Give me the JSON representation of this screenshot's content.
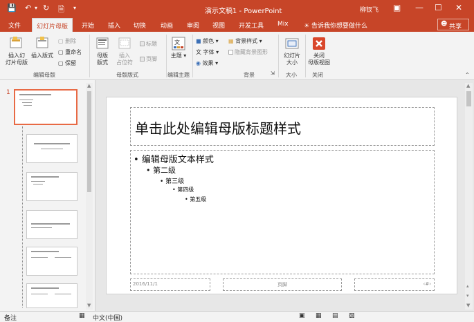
{
  "title_bar": {
    "title": "演示文稿1 - PowerPoint",
    "user": "柳钗飞"
  },
  "tabs": [
    {
      "label": "文件"
    },
    {
      "label": "幻灯片母版"
    },
    {
      "label": "开始"
    },
    {
      "label": "插入"
    },
    {
      "label": "切换"
    },
    {
      "label": "动画"
    },
    {
      "label": "审阅"
    },
    {
      "label": "视图"
    },
    {
      "label": "开发工具"
    },
    {
      "label": "Mix"
    }
  ],
  "tell_me": "告诉我你想要做什么",
  "share": "共享",
  "ribbon": {
    "edit_master": {
      "insert_master": "插入幻\n灯片母版",
      "insert_layout": "插入版式",
      "delete": "删除",
      "rename": "重命名",
      "preserve": "保留",
      "group": "编辑母版"
    },
    "master_layout": {
      "master_layout_btn": "母版\n版式",
      "insert_placeholder": "插入\n占位符",
      "title_chk": "标题",
      "footer_chk": "页脚",
      "group": "母版版式"
    },
    "edit_theme": {
      "theme": "主题",
      "group": "编辑主题"
    },
    "background": {
      "colors": "颜色",
      "fonts": "字体",
      "effects": "效果",
      "bg_styles": "背景样式",
      "hide_bg": "隐藏背景图形",
      "group": "背景"
    },
    "size": {
      "slide_size": "幻灯片\n大小",
      "group": "大小"
    },
    "close": {
      "close_master": "关闭\n母版视图",
      "group": "关闭"
    }
  },
  "thumbnails": {
    "first_number": "1"
  },
  "slide": {
    "title": "单击此处编辑母版标题样式",
    "levels": [
      "编辑母版文本样式",
      "第二级",
      "第三级",
      "第四级",
      "第五级"
    ],
    "date": "2016/11/1",
    "footer": "页脚",
    "page_num": "‹#›"
  },
  "status_bar": {
    "notes": "备注",
    "lang": "中文(中国)"
  },
  "colors": {
    "accent": "#c74528",
    "selected_thumb": "#e86a45"
  }
}
